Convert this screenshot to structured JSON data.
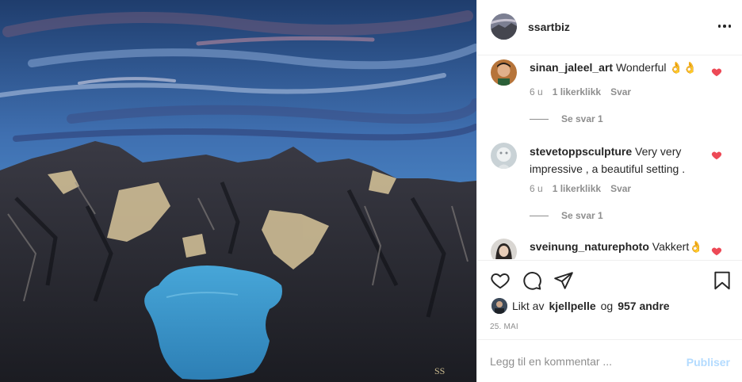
{
  "post": {
    "username": "ssartbiz",
    "signature": "SS",
    "colors": {
      "sky": "#3f73b8",
      "lake": "#3a96c8",
      "rock": "#2a2b33",
      "snow": "#d8c59a"
    }
  },
  "comments": [
    {
      "username": "sinan_jaleel_art",
      "text": "Wonderful 👌👌",
      "time": "6 u",
      "likes": "1 likerklikk",
      "reply": "Svar",
      "replies": "Se svar 1",
      "liked": true
    },
    {
      "username": "stevetoppsculpture",
      "text": "Very very impressive , a beautiful setting .",
      "time": "6 u",
      "likes": "1 likerklikk",
      "reply": "Svar",
      "replies": "Se svar 1",
      "liked": true
    },
    {
      "username": "sveinung_naturephoto",
      "text": "Vakkert👌",
      "liked": true
    }
  ],
  "actions": {
    "icons": [
      "heart-icon",
      "comment-icon",
      "share-icon",
      "bookmark-icon"
    ],
    "liked_by_prefix": "Likt av",
    "liked_by_user": "kjellpelle",
    "liked_by_joiner": "og",
    "liked_by_others": "957 andre",
    "date": "25. MAI"
  },
  "add_comment": {
    "placeholder": "Legg til en kommentar ...",
    "publish_label": "Publiser"
  },
  "accent_colors": {
    "heart": "#ed4956",
    "publish_disabled": "#b3dbff",
    "meta": "#8e8e8e"
  }
}
